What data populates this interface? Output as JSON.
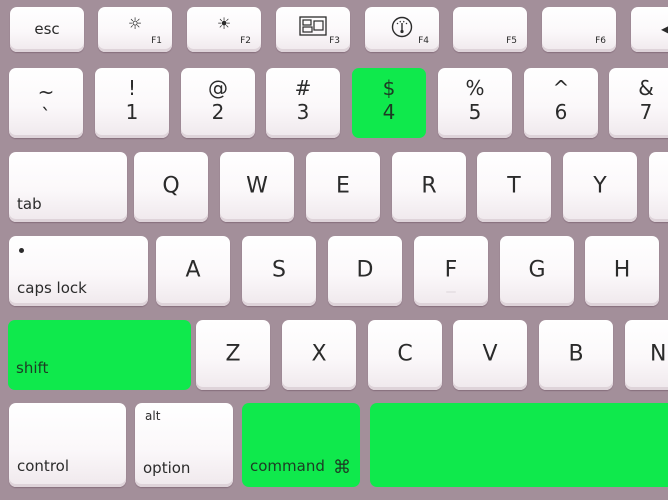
{
  "colors": {
    "background": "#a38f9a",
    "key_face": "#ffffff",
    "highlight": "#0fe94c"
  },
  "highlighted_keys": [
    "4",
    "shift",
    "command",
    "space"
  ],
  "function_row": [
    {
      "label": "esc"
    },
    {
      "label": "F1",
      "icon": "brightness-down-icon",
      "glyph": "☼"
    },
    {
      "label": "F2",
      "icon": "brightness-up-icon",
      "glyph": "☀"
    },
    {
      "label": "F3",
      "icon": "mission-control-icon",
      "glyph": "⊞"
    },
    {
      "label": "F4",
      "icon": "dashboard-gauge-icon",
      "glyph": "◔"
    },
    {
      "label": "F5"
    },
    {
      "label": "F6"
    },
    {
      "label": "",
      "icon": "rewind-icon",
      "glyph": "◀"
    }
  ],
  "number_row": [
    {
      "top": "~",
      "bottom": "`"
    },
    {
      "top": "!",
      "bottom": "1"
    },
    {
      "top": "@",
      "bottom": "2"
    },
    {
      "top": "#",
      "bottom": "3"
    },
    {
      "top": "$",
      "bottom": "4"
    },
    {
      "top": "%",
      "bottom": "5"
    },
    {
      "top": "^",
      "bottom": "6"
    },
    {
      "top": "&",
      "bottom": "7"
    }
  ],
  "qwerty_row": {
    "tab": "tab",
    "letters": [
      "Q",
      "W",
      "E",
      "R",
      "T",
      "Y"
    ]
  },
  "home_row": {
    "caps_lock": "caps lock",
    "letters": [
      "A",
      "S",
      "D",
      "F",
      "G",
      "H"
    ]
  },
  "shift_row": {
    "shift": "shift",
    "letters": [
      "Z",
      "X",
      "C",
      "V",
      "B",
      "N"
    ]
  },
  "bottom_row": {
    "control": "control",
    "option_alt": "alt",
    "option": "option",
    "command": "command",
    "command_glyph": "⌘",
    "space": ""
  }
}
